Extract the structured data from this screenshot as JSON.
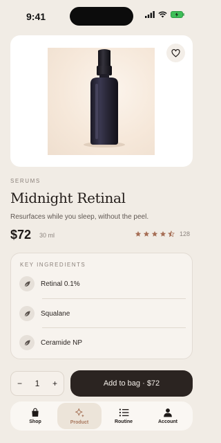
{
  "status_bar": {
    "time": "9:41"
  },
  "product": {
    "category": "SERUMS",
    "title": "Midnight Retinal",
    "subtitle": "Resurfaces while you sleep, without the peel.",
    "price": "$72",
    "volume": "30 ml",
    "rating": 4.5,
    "review_count": "128"
  },
  "ingredients": {
    "heading": "KEY INGREDIENTS",
    "items": [
      {
        "label": "Retinal 0.1%",
        "icon": "leaf-icon"
      },
      {
        "label": "Squalane",
        "icon": "leaf-icon"
      },
      {
        "label": "Ceramide NP",
        "icon": "leaf-icon"
      }
    ]
  },
  "cart": {
    "minus": "−",
    "quantity": "1",
    "plus": "+",
    "add_label": "Add to bag · $72"
  },
  "tabs": [
    {
      "label": "Shop",
      "icon": "shopping-bag-icon",
      "active": false
    },
    {
      "label": "Product",
      "icon": "sparkle-icon",
      "active": true
    },
    {
      "label": "Routine",
      "icon": "list-icon",
      "active": false
    },
    {
      "label": "Account",
      "icon": "person-icon",
      "active": false
    }
  ],
  "colors": {
    "background": "#f1ece5",
    "accent": "#a9785e",
    "star": "#a66e55",
    "button_dark": "#2b2421"
  }
}
